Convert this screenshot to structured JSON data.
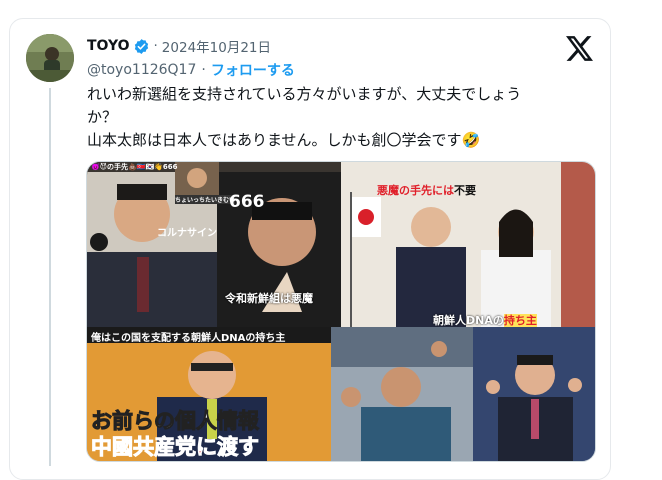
{
  "tweet": {
    "author_name": "TOYO",
    "date": "2024年10月21日",
    "handle": "@toyo1126Q17",
    "separator": "·",
    "follow_label": "フォローする",
    "text": "れいわ新選組を支持されている方々がいますが、大丈夫でしょう\nか？\n山本太郎は日本人ではありません。しかも創〇学会です🤣"
  },
  "media": {
    "panel1": {
      "top_caption": "👿😈の手先💩🇰🇵🇰🇷👋666",
      "inset_caption": "ちょいっちたいきむい",
      "number": "666",
      "caption_korunasain": "コルナサイン",
      "caption_bottom": "令和新鮮組は悪魔"
    },
    "panel2": {
      "caption_top_red": "悪魔の手先には",
      "caption_top_black": "不要",
      "caption_bottom_white": "朝鮮人DNAの",
      "caption_bottom_red": "持ち主"
    },
    "panel3": {
      "caption_top": "俺はこの国を支配する朝鮮人DNAの持ち主",
      "caption_line1": "お前らの個人情報",
      "caption_line2": "中國共産党に渡す"
    }
  },
  "colors": {
    "link_blue": "#1d9bf0",
    "text": "#0f1419",
    "secondary": "#536471",
    "border": "#cfd9de",
    "caption_red": "#e0202a"
  }
}
